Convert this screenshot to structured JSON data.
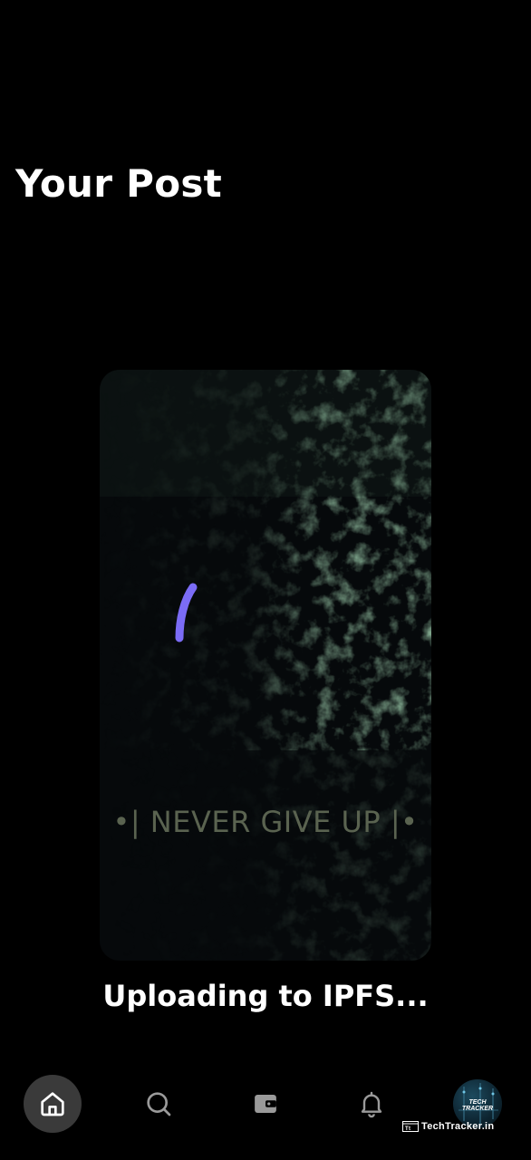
{
  "header": {
    "title": "Your Post"
  },
  "post": {
    "caption": "•| NEVER GIVE UP |•",
    "upload_status": "Uploading to IPFS..."
  },
  "colors": {
    "background": "#000000",
    "spinner": "#7b6cf6",
    "active_nav": "#3a3a3a"
  },
  "nav": {
    "items": [
      {
        "name": "home",
        "icon": "home-icon",
        "active": true
      },
      {
        "name": "search",
        "icon": "search-icon",
        "active": false
      },
      {
        "name": "wallet",
        "icon": "wallet-icon",
        "active": false
      },
      {
        "name": "notifications",
        "icon": "bell-icon",
        "active": false
      },
      {
        "name": "profile",
        "icon": "avatar",
        "active": false
      }
    ],
    "avatar_text": "TECH TRACKER"
  },
  "watermark": {
    "text": "TechTracker.in"
  }
}
